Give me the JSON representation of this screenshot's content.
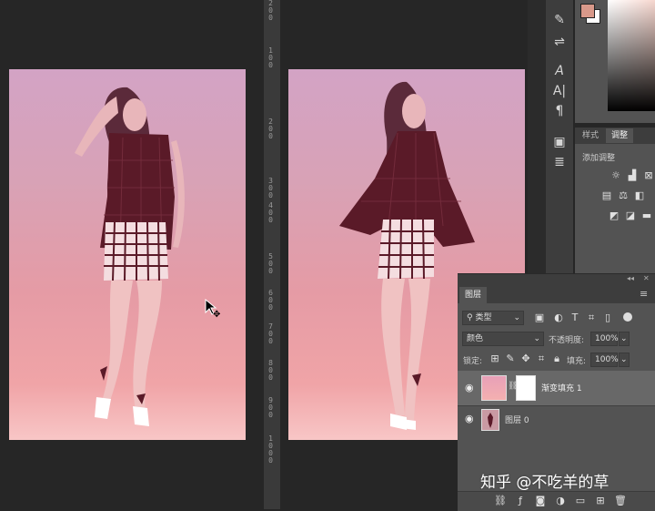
{
  "colors": {
    "foreground": "#d9998a",
    "background": "#ffffff",
    "gradient_thumb": "#f0a3b0"
  },
  "ruler": {
    "labels": [
      "2 0 0",
      "1 0 0",
      "2 0 0",
      "3 0 0",
      "4 0 0",
      "5 0 0",
      "6 0 0",
      "7 0 0",
      "8 0 0",
      "9 0 0",
      "1 0 0 0"
    ]
  },
  "toolbar": {
    "icons": [
      "brush-icon",
      "sliders-icon",
      "character-icon",
      "paragraph-style-icon",
      "paragraph-icon",
      "swatches-icon",
      "notes-icon"
    ],
    "glyphs": [
      "✎",
      "⇌",
      "A",
      "A|",
      "¶",
      "▣",
      "≣"
    ]
  },
  "styles_panel": {
    "tab_styles": "样式",
    "tab_adjustments": "调整",
    "add_adjustment": "添加调整"
  },
  "layers_panel": {
    "title": "图层",
    "filter_kind": "类型",
    "blend_mode": "颜色",
    "opacity_label": "不透明度:",
    "opacity_value": "100%",
    "lock_label": "锁定:",
    "fill_label": "填充:",
    "fill_value": "100%",
    "layers": [
      {
        "name": "渐变填充 1"
      },
      {
        "name": "图层 0"
      }
    ]
  },
  "watermark": "知乎 @不吃羊的草"
}
